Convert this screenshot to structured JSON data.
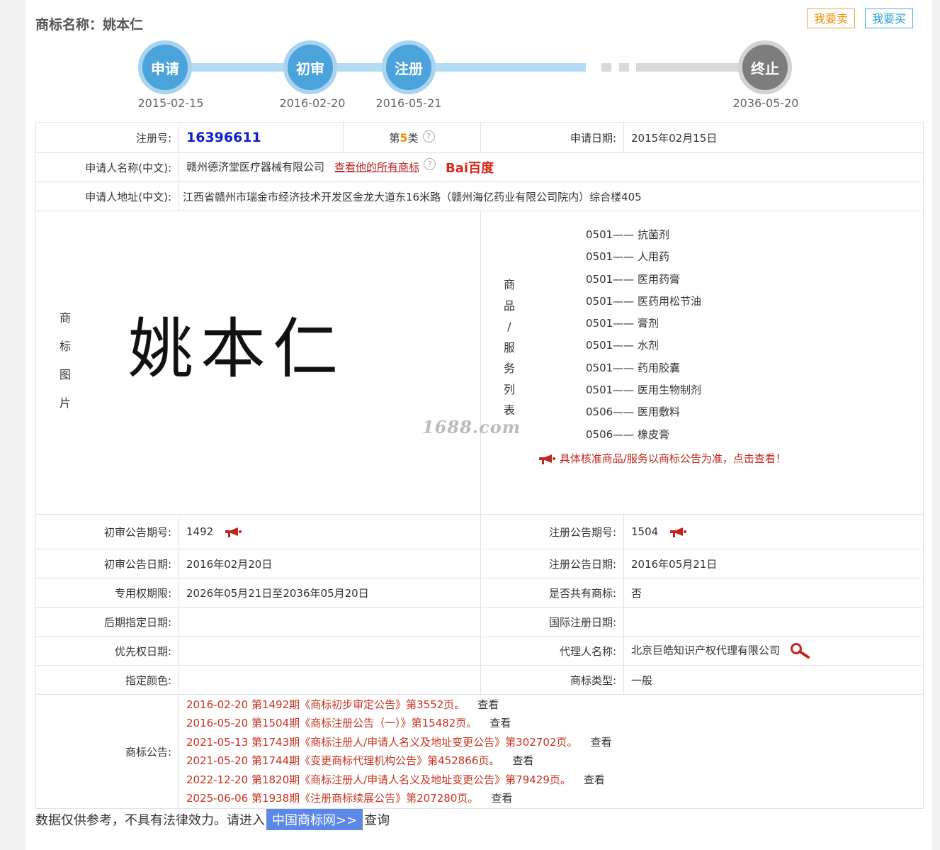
{
  "header": {
    "title": "商标名称：姚本仁",
    "sell_label": "我要卖",
    "buy_label": "我要买"
  },
  "timeline": {
    "steps": [
      {
        "label": "申请",
        "date": "2015-02-15"
      },
      {
        "label": "初审",
        "date": "2016-02-20"
      },
      {
        "label": "注册",
        "date": "2016-05-21"
      },
      {
        "label": "终止",
        "date": "2036-05-20"
      }
    ]
  },
  "info": {
    "reg_no_label": "注册号:",
    "reg_no": "16396611",
    "class_prefix": "第",
    "class_num": "5",
    "class_suffix": "类",
    "apply_date_label": "申请日期:",
    "apply_date": "2015年02月15日",
    "applicant_label": "申请人名称(中文):",
    "applicant": "赣州德济堂医疗器械有限公司",
    "all_marks_link": "查看他的所有商标",
    "baidu_label": "Bai百度",
    "address_label": "申请人地址(中文):",
    "address": "江西省赣州市瑞金市经济技术开发区金龙大道东16米路（赣州海亿药业有限公司院内）综合楼405",
    "image_label_chars": [
      "商",
      "标",
      "图",
      "片"
    ],
    "image_text": "姚本仁",
    "watermark": "1688.com",
    "goods_label_chars": [
      "商",
      "品",
      "/",
      "服",
      "务",
      "列",
      "表"
    ],
    "goods": [
      "0501—— 抗菌剂",
      "0501—— 人用药",
      "0501—— 医用药膏",
      "0501—— 医药用松节油",
      "0501—— 膏剂",
      "0501—— 水剂",
      "0501—— 药用胶囊",
      "0501—— 医用生物制剂",
      "0506—— 医用敷料",
      "0506—— 橡皮膏"
    ],
    "goods_notice": "具体核准商品/服务以商标公告为准，点击查看！",
    "prelim_issue_label": "初审公告期号:",
    "prelim_issue": "1492",
    "reg_issue_label": "注册公告期号:",
    "reg_issue": "1504",
    "prelim_date_label": "初审公告日期:",
    "prelim_date": "2016年02月20日",
    "reg_date_label": "注册公告日期:",
    "reg_date": "2016年05月21日",
    "term_label": "专用权期限:",
    "term": "2026年05月21日至2036年05月20日",
    "shared_label": "是否共有商标:",
    "shared": "否",
    "later_date_label": "后期指定日期:",
    "later_date": "",
    "intl_date_label": "国际注册日期:",
    "intl_date": "",
    "priority_label": "优先权日期:",
    "priority": "",
    "agent_label": "代理人名称:",
    "agent": "北京巨皓知识产权代理有限公司",
    "color_label": "指定颜色:",
    "color": "",
    "type_label": "商标类型:",
    "type": "一般",
    "announce_label": "商标公告:",
    "announcements": [
      {
        "text": "2016-02-20 第1492期《商标初步审定公告》第3552页。",
        "view": "查看"
      },
      {
        "text": "2016-05-20 第1504期《商标注册公告（一）》第15482页。",
        "view": "查看"
      },
      {
        "text": "2021-05-13 第1743期《商标注册人/申请人名义及地址变更公告》第302702页。",
        "view": "查看"
      },
      {
        "text": "2021-05-20 第1744期《变更商标代理机构公告》第452866页。",
        "view": "查看"
      },
      {
        "text": "2022-12-20 第1820期《商标注册人/申请人名义及地址变更公告》第79429页。",
        "view": "查看"
      },
      {
        "text": "2025-06-06 第1938期《注册商标续展公告》第207280页。",
        "view": "查看"
      }
    ]
  },
  "footer": {
    "text_before": "数据仅供参考，不具有法律效力。请进入",
    "link": "中国商标网>>",
    "text_after": "查询"
  },
  "colors": {
    "accent_blue": "#4ba3db",
    "timeline_light": "#b3dcf2",
    "end_gray": "#7d7d7d",
    "notice_red": "#c9331f",
    "reg_no_blue": "#1020d0",
    "class_orange": "#f08c00"
  }
}
